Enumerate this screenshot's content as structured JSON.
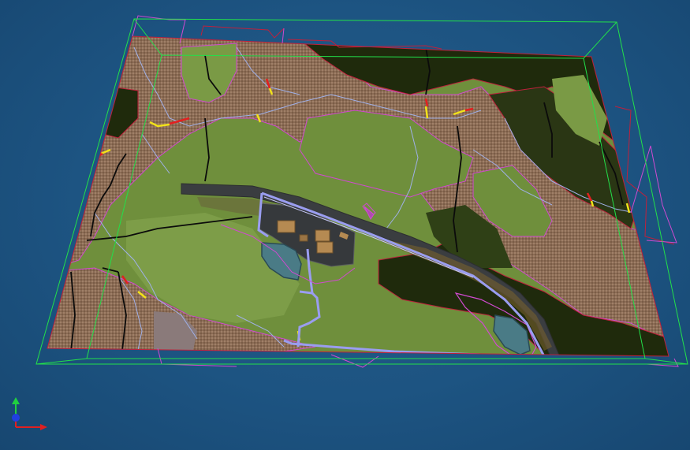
{
  "view": {
    "title": "",
    "background_color": "#1d5482",
    "bounding_box_color": "#22e04a"
  },
  "terrain": {
    "colors": {
      "grass": "#6f8f3c",
      "grass_light": "#85a84f",
      "dark_forest": "#1f2a0c",
      "bare_soil": "#8b6c55",
      "road": "#3a3d40",
      "road_edge": "#9a9df0",
      "water": "#4a7b86",
      "building_roof": "#b58a52",
      "yard": "#36393c"
    },
    "line_colors": {
      "streams": "#9fb0e8",
      "ridges": "#0b0b0b",
      "zone_boundary": "#d04ad0",
      "hazard_red": "#e22020",
      "hazard_yellow": "#f2e21a",
      "parcel": "#c0203c"
    }
  },
  "axis_gizmo": {
    "x_color": "#e02020",
    "y_color": "#20d040",
    "z_color": "#2040e0"
  }
}
